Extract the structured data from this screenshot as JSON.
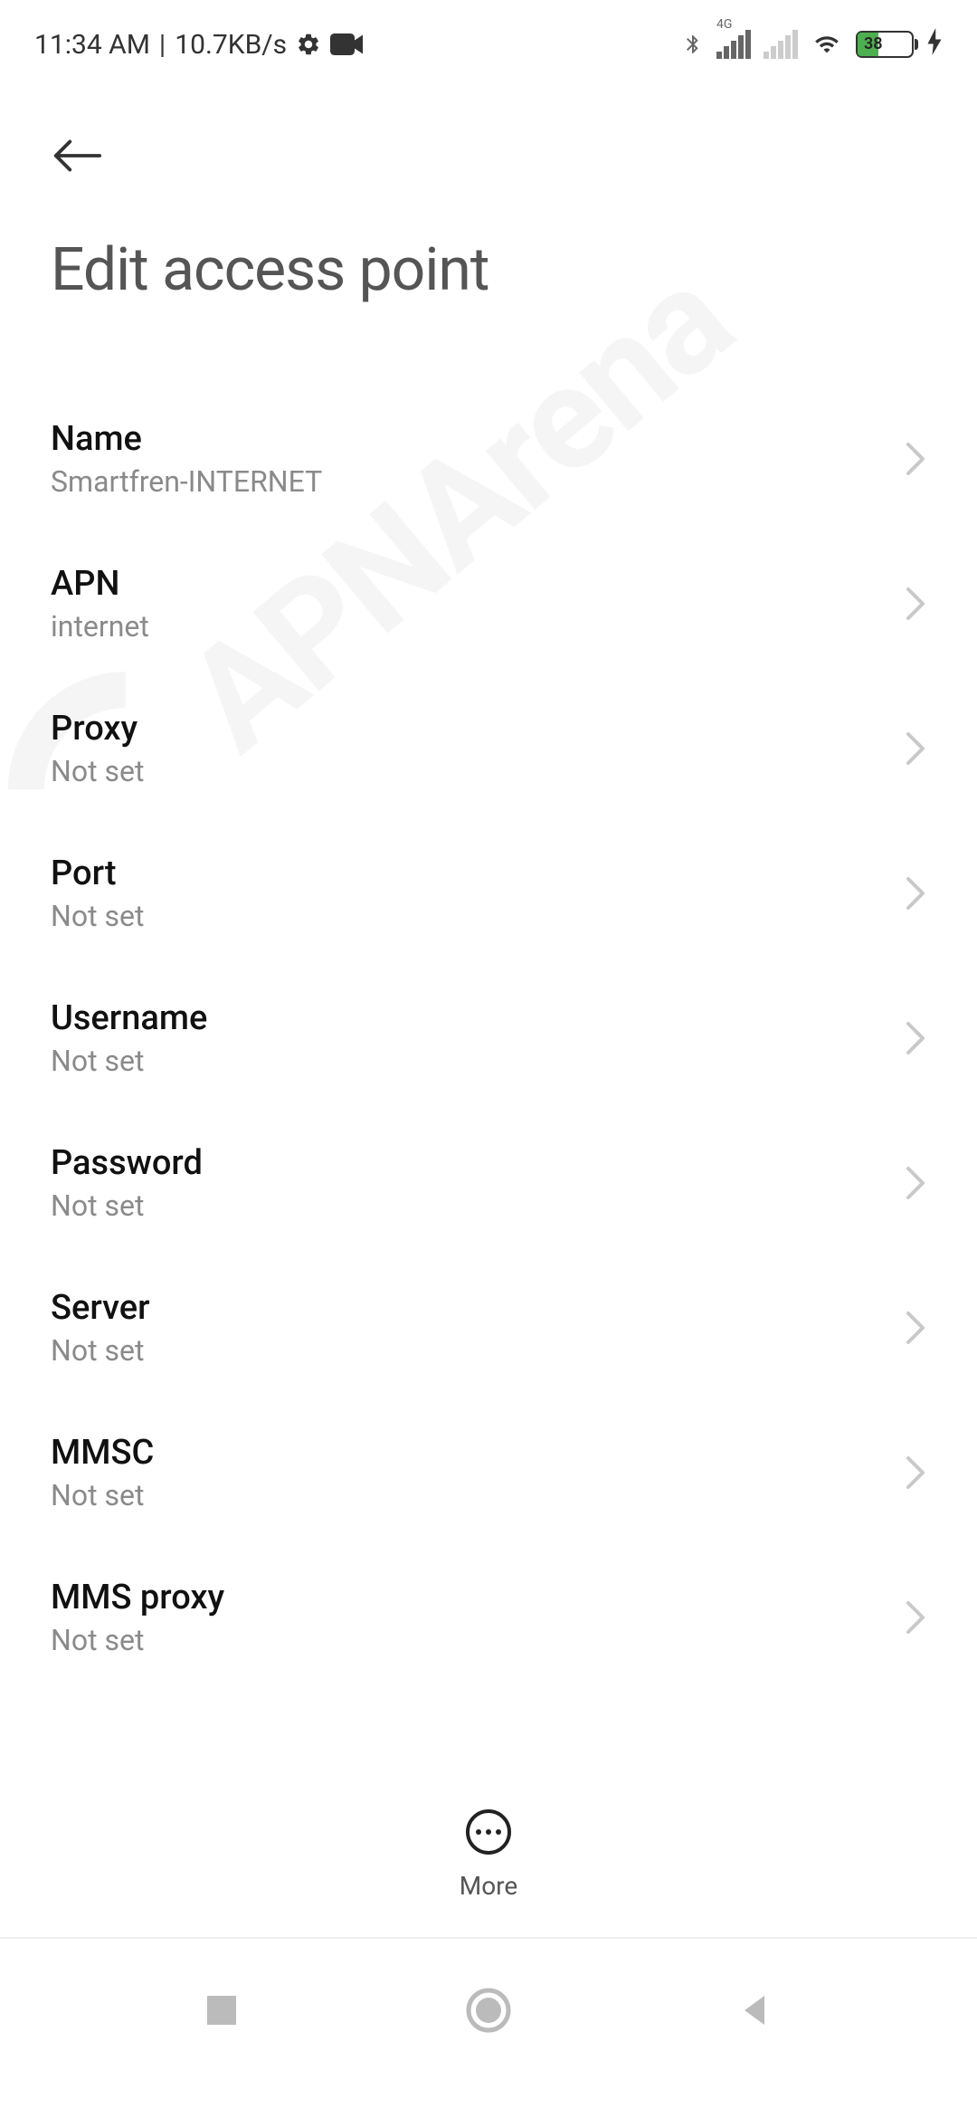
{
  "status_bar": {
    "time": "11:34 AM",
    "separator": "|",
    "network_speed": "10.7KB/s",
    "network_type": "4G",
    "battery_percent": "38"
  },
  "header": {
    "title": "Edit access point"
  },
  "settings": {
    "items": [
      {
        "label": "Name",
        "value": "Smartfren-INTERNET"
      },
      {
        "label": "APN",
        "value": "internet"
      },
      {
        "label": "Proxy",
        "value": "Not set"
      },
      {
        "label": "Port",
        "value": "Not set"
      },
      {
        "label": "Username",
        "value": "Not set"
      },
      {
        "label": "Password",
        "value": "Not set"
      },
      {
        "label": "Server",
        "value": "Not set"
      },
      {
        "label": "MMSC",
        "value": "Not set"
      },
      {
        "label": "MMS proxy",
        "value": "Not set"
      }
    ]
  },
  "footer": {
    "more_label": "More"
  },
  "watermark": {
    "text": "APNArena"
  }
}
